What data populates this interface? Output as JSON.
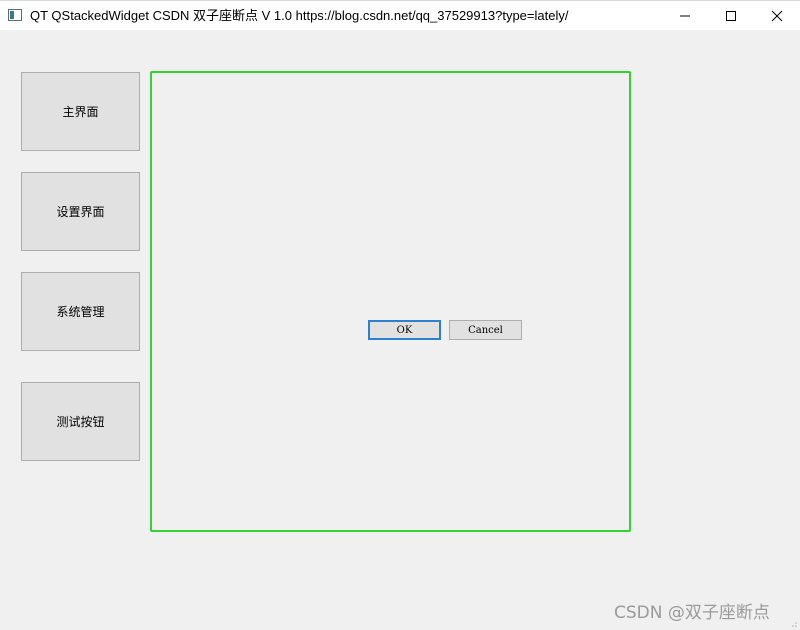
{
  "window": {
    "title": "QT QStackedWidget  CSDN 双子座断点 V 1.0 https://blog.csdn.net/qq_37529913?type=lately/"
  },
  "sidebar": {
    "items": [
      {
        "label": "主界面"
      },
      {
        "label": "设置界面"
      },
      {
        "label": "系统管理"
      },
      {
        "label": "测试按钮"
      }
    ]
  },
  "stacked_page": {
    "ok_label": "OK",
    "cancel_label": "Cancel"
  },
  "watermark": {
    "text": "CSDN @双子座断点"
  },
  "colors": {
    "frame_border": "#33d233",
    "ok_focus_border": "#2f7fcf",
    "button_face": "#e1e1e1",
    "window_bg": "#f0f0f0"
  },
  "icons": [
    "app-icon",
    "minimize-icon",
    "maximize-icon",
    "close-icon",
    "size-grip-icon"
  ]
}
